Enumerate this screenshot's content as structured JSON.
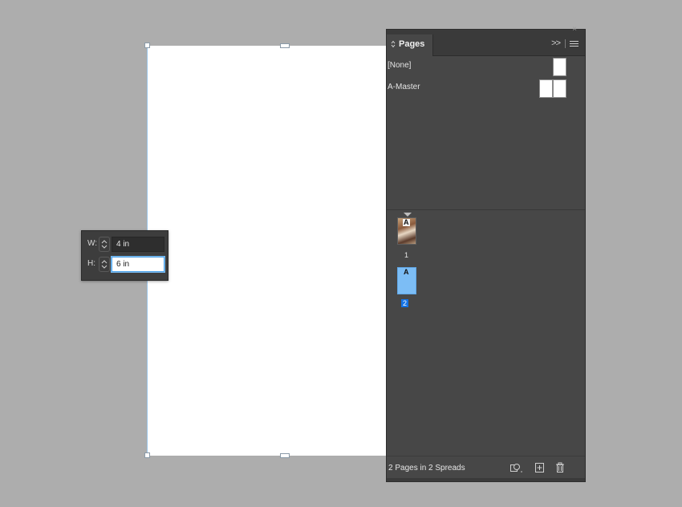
{
  "size_popup": {
    "width_label": "W:",
    "width_value": "4 in",
    "height_label": "H:",
    "height_value": "6 in"
  },
  "pages_panel": {
    "tab_label": "Pages",
    "masters": [
      {
        "name": "[None]"
      },
      {
        "name": "A-Master"
      }
    ],
    "pages": [
      {
        "number": "1",
        "master_prefix": "A",
        "selected": false
      },
      {
        "number": "2",
        "master_prefix": "A",
        "selected": true
      }
    ],
    "footer_status": "2 Pages in 2 Spreads"
  },
  "colors": {
    "canvas_bg": "#adadad",
    "panel_bg": "#474747",
    "selection_blue": "#1473e6",
    "selected_thumb": "#7cbdf5"
  },
  "icons": {
    "collapse": "double-chevron-right-icon",
    "menu": "hamburger-menu-icon",
    "edit_page_size": "edit-page-size-icon",
    "new_page": "new-page-icon",
    "delete": "trash-icon"
  }
}
